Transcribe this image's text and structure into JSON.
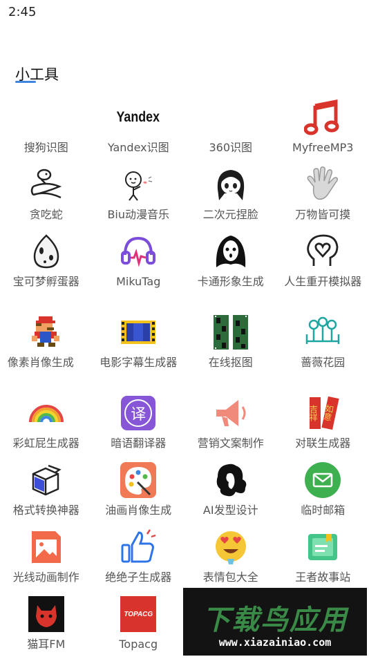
{
  "status_bar": {
    "time": "2:45"
  },
  "section": {
    "title": "小工具"
  },
  "tools": [
    {
      "label": "搜狗识图",
      "icon": "blank-icon"
    },
    {
      "label": "Yandex识图",
      "icon": "yandex-logo-icon",
      "icon_text": "Yandex"
    },
    {
      "label": "360识图",
      "icon": "blank-icon"
    },
    {
      "label": "MyfreeMP3",
      "icon": "music-note-icon"
    },
    {
      "label": "贪吃蛇",
      "icon": "snake-icon"
    },
    {
      "label": "Biu动漫音乐",
      "icon": "doodle-character-icon"
    },
    {
      "label": "二次元捏脸",
      "icon": "anime-girl-icon"
    },
    {
      "label": "万物皆可摸",
      "icon": "hand-icon"
    },
    {
      "label": "宝可梦孵蛋器",
      "icon": "egg-icon"
    },
    {
      "label": "MikuTag",
      "icon": "headphones-icon"
    },
    {
      "label": "卡通形象生成",
      "icon": "ghost-face-icon"
    },
    {
      "label": "人生重开模拟器",
      "icon": "head-heart-icon"
    },
    {
      "label": "像素肖像生成",
      "icon": "pixel-mario-icon"
    },
    {
      "label": "电影字幕生成器",
      "icon": "film-strip-icon"
    },
    {
      "label": "在线抠图",
      "icon": "film-grid-icon"
    },
    {
      "label": "蔷薇花园",
      "icon": "garden-trees-icon"
    },
    {
      "label": "彩虹屁生成器",
      "icon": "rainbow-icon"
    },
    {
      "label": "暗语翻译器",
      "icon": "translate-icon",
      "icon_text": "译"
    },
    {
      "label": "营销文案制作",
      "icon": "megaphone-icon"
    },
    {
      "label": "对联生成器",
      "icon": "couplet-icon",
      "icon_text_left": "吉祥",
      "icon_text_right": "如意"
    },
    {
      "label": "格式转换神器",
      "icon": "cube-convert-icon"
    },
    {
      "label": "油画肖像生成",
      "icon": "palette-icon"
    },
    {
      "label": "AI发型设计",
      "icon": "hair-silhouette-icon"
    },
    {
      "label": "临时邮箱",
      "icon": "mail-icon"
    },
    {
      "label": "光线动画制作",
      "icon": "image-frame-icon"
    },
    {
      "label": "绝绝子生成器",
      "icon": "thumbs-up-icon"
    },
    {
      "label": "表情包大全",
      "icon": "emoji-heart-eyes-icon"
    },
    {
      "label": "王者故事站",
      "icon": "book-icon"
    },
    {
      "label": "猫耳FM",
      "icon": "cat-ear-icon"
    },
    {
      "label": "Topacg",
      "icon": "topacg-logo-icon",
      "icon_text": "TOPACG"
    }
  ],
  "watermark": {
    "title": "下载鸟应用",
    "url": "www.xiazainiao.com"
  },
  "colors": {
    "accent": "#3f86e0",
    "red": "#d9342b",
    "purple": "#7c4ddb",
    "green": "#3fb04f"
  }
}
